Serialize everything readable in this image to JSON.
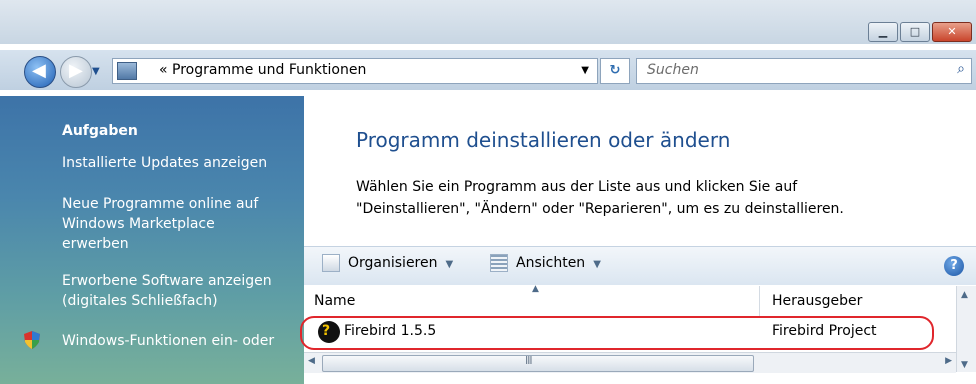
{
  "window": {
    "controls": {
      "minimize_icon": "minimize-icon",
      "maximize_icon": "maximize-icon",
      "close_icon": "close-icon"
    }
  },
  "nav": {
    "address_prefix": "«",
    "address_text": "Programme und Funktionen",
    "search_placeholder": "Suchen"
  },
  "sidebar": {
    "heading": "Aufgaben",
    "items": [
      {
        "label": "Installierte Updates anzeigen"
      },
      {
        "label_line1": "Neue Programme online auf",
        "label_line2": "Windows Marketplace",
        "label_line3": "erwerben"
      },
      {
        "label_line1": "Erworbene Software anzeigen",
        "label_line2": "(digitales Schließfach)"
      },
      {
        "label": "Windows-Funktionen ein- oder",
        "icon": "shield-icon"
      }
    ]
  },
  "main": {
    "title": "Programm deinstallieren oder ändern",
    "desc_line1": "Wählen Sie ein Programm aus der Liste aus und klicken Sie auf",
    "desc_line2": "\"Deinstallieren\", \"Ändern\" oder \"Reparieren\", um es zu deinstallieren."
  },
  "toolbar": {
    "organize_label": "Organisieren",
    "views_label": "Ansichten"
  },
  "list": {
    "columns": [
      "Name",
      "Herausgeber"
    ],
    "rows": [
      {
        "name": "Firebird 1.5.5",
        "publisher": "Firebird Project",
        "icon": "firebird-icon"
      }
    ]
  },
  "colors": {
    "highlight": "#e0262c",
    "title_blue": "#1f4f8f"
  }
}
